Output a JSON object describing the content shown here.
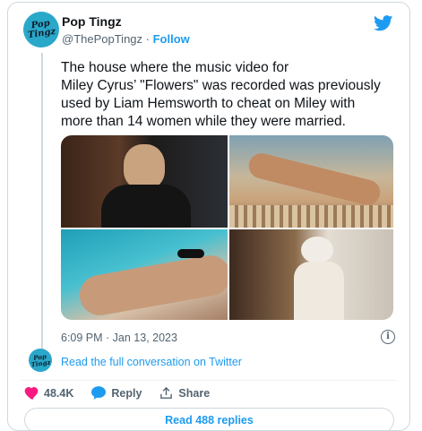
{
  "author": {
    "name": "Pop Tingz",
    "handle": "@ThePopTingz",
    "separator": " · ",
    "follow_label": "Follow",
    "avatar_text_line1": "Pop",
    "avatar_text_line2": "Tingz"
  },
  "tweet": {
    "text": "The house where the music video for\nMiley Cyrus’ \"Flowers\" was recorded was previously\nused by Liam Hemsworth to cheat on Miley with\nmore than 14 women while they were married.",
    "timestamp": "6:09 PM · Jan 13, 2023",
    "media": [
      {
        "icon": "photo-woman-dark-jacket"
      },
      {
        "icon": "photo-woman-lying-poolside"
      },
      {
        "icon": "photo-woman-sunglasses-pool"
      },
      {
        "icon": "photo-woman-white-robe"
      }
    ]
  },
  "links": {
    "read_conversation": "Read the full conversation on Twitter"
  },
  "actions": {
    "likes": "48.4K",
    "reply_label": "Reply",
    "share_label": "Share",
    "read_replies": "Read 488 replies"
  },
  "colors": {
    "accent": "#1d9bf0",
    "like": "#f91880",
    "muted": "#536471",
    "text": "#0f1419",
    "border": "#cfd9de"
  }
}
